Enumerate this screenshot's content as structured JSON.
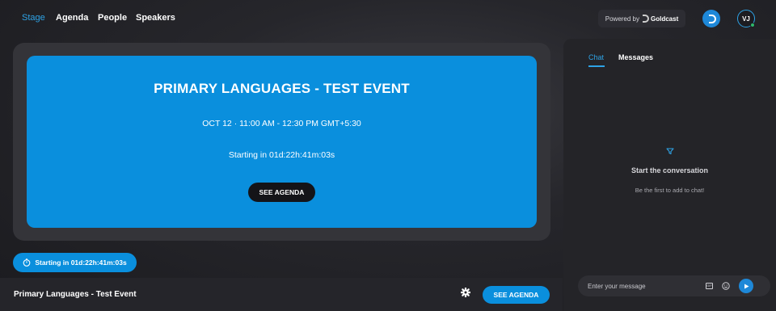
{
  "nav": {
    "items": [
      {
        "label": "Stage",
        "active": true
      },
      {
        "label": "Agenda",
        "active": false
      },
      {
        "label": "People",
        "active": false
      },
      {
        "label": "Speakers",
        "active": false
      }
    ],
    "powered_by": "Powered by",
    "brand": "Goldcast",
    "avatar_initials": "VJ"
  },
  "stage": {
    "title": "PRIMARY LANGUAGES - TEST EVENT",
    "date": "OCT 12 · 11:00 AM - 12:30 PM GMT+5:30",
    "countdown": "Starting in 01d:22h:41m:03s",
    "agenda_button": "SEE AGENDA"
  },
  "countdown_pill": {
    "label": "Starting in 01d:22h:41m:03s"
  },
  "bottom_bar": {
    "event_name": "Primary Languages - Test Event",
    "agenda_button": "SEE AGENDA"
  },
  "chat": {
    "tabs": [
      {
        "label": "Chat",
        "active": true
      },
      {
        "label": "Messages",
        "active": false
      }
    ],
    "empty_title": "Start the conversation",
    "empty_subtitle": "Be the first to add to chat!",
    "input_placeholder": "Enter your message",
    "gif_label": "GIF"
  },
  "colors": {
    "accent": "#0a8fdd",
    "background": "#1b1b1f",
    "panel": "#242428"
  }
}
